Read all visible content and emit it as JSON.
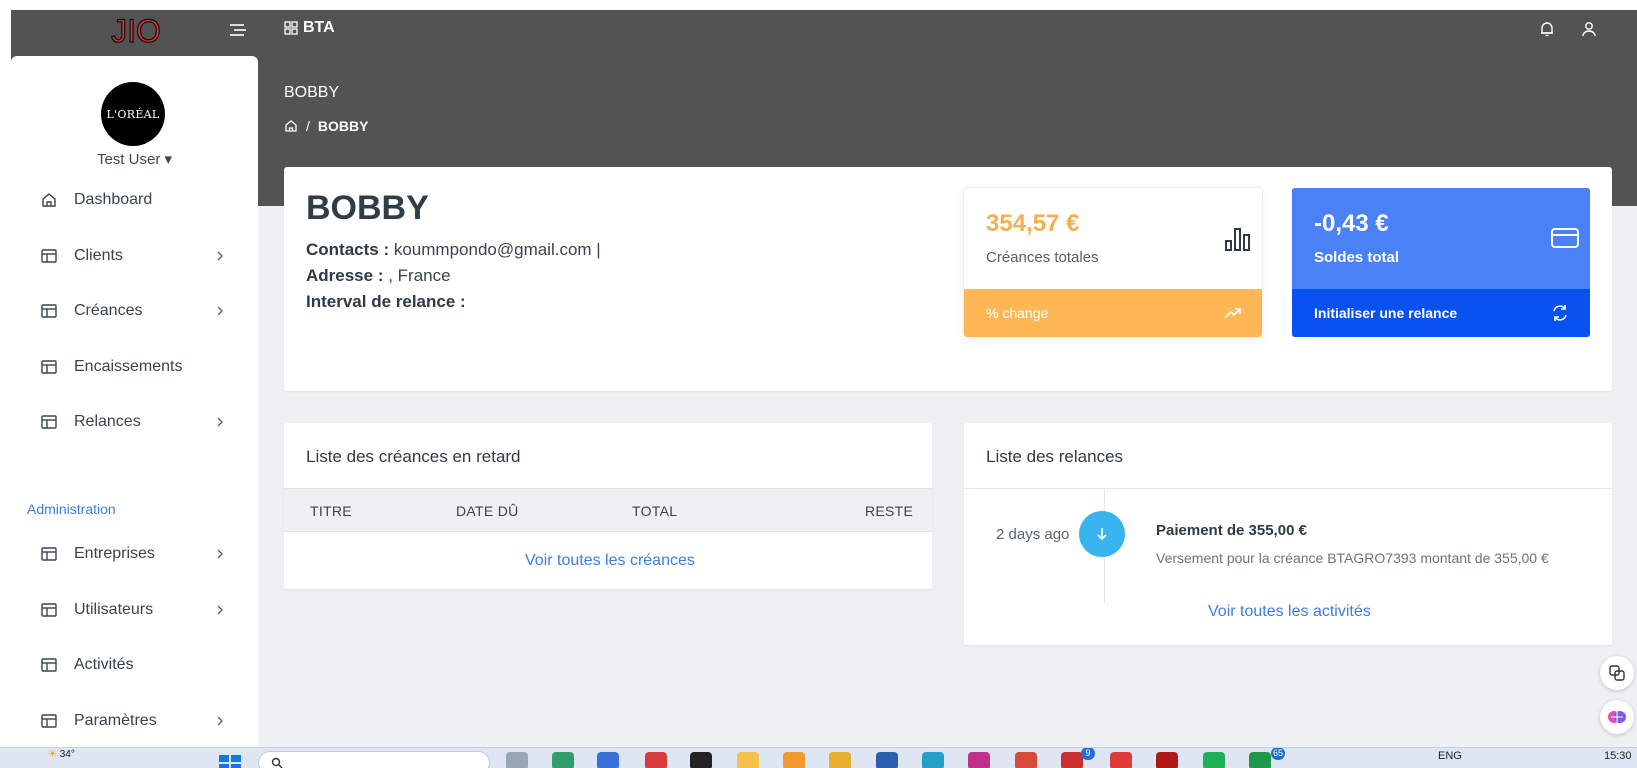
{
  "header": {
    "logo_text": "JIO",
    "brand": "BTA"
  },
  "sidebar": {
    "avatar_text": "L'ORÉAL",
    "username": "Test User",
    "items": [
      {
        "label": "Dashboard",
        "icon": "home-icon",
        "chevron": false
      },
      {
        "label": "Clients",
        "icon": "layout-icon",
        "chevron": true
      },
      {
        "label": "Créances",
        "icon": "layout-icon",
        "chevron": true
      },
      {
        "label": "Encaissements",
        "icon": "layout-icon",
        "chevron": false
      },
      {
        "label": "Relances",
        "icon": "layout-icon",
        "chevron": true
      }
    ],
    "section_title": "Administration",
    "admin_items": [
      {
        "label": "Entreprises",
        "icon": "layout-icon",
        "chevron": true
      },
      {
        "label": "Utilisateurs",
        "icon": "layout-icon",
        "chevron": true
      },
      {
        "label": "Activités",
        "icon": "layout-icon",
        "chevron": false
      },
      {
        "label": "Paramètres",
        "icon": "layout-icon",
        "chevron": true
      }
    ]
  },
  "page": {
    "title": "BOBBY",
    "breadcrumb_current": "BOBBY"
  },
  "profile": {
    "name": "BOBBY",
    "contacts_label": "Contacts :",
    "contacts_value": " koummpondo@gmail.com |",
    "address_label": "Adresse :",
    "address_value": " , France",
    "interval_label": "Interval de relance :"
  },
  "stats": {
    "creances": {
      "amount": "354,57 €",
      "label": "Créances totales",
      "footer": "% change",
      "color": "#fdb855"
    },
    "soldes": {
      "amount": "-0,43 €",
      "label": "Soldes total",
      "footer": "Initialiser une relance",
      "color": "#4a82f6"
    }
  },
  "late_list": {
    "title": "Liste des créances en retard",
    "columns": [
      "TITRE",
      "DATE DÛ",
      "TOTAL",
      "RESTE"
    ],
    "link": "Voir toutes les créances"
  },
  "relances": {
    "title": "Liste des relances",
    "items": [
      {
        "time": "2 days ago",
        "title": "Paiement de 355,00 €",
        "desc": "Versement pour la créance BTAGRO7393 montant de 355,00 €"
      }
    ],
    "link": "Voir toutes les activités"
  },
  "taskbar": {
    "weather": "34°",
    "language": "ENG",
    "time": "15:30",
    "badges": [
      "9",
      "65"
    ]
  }
}
